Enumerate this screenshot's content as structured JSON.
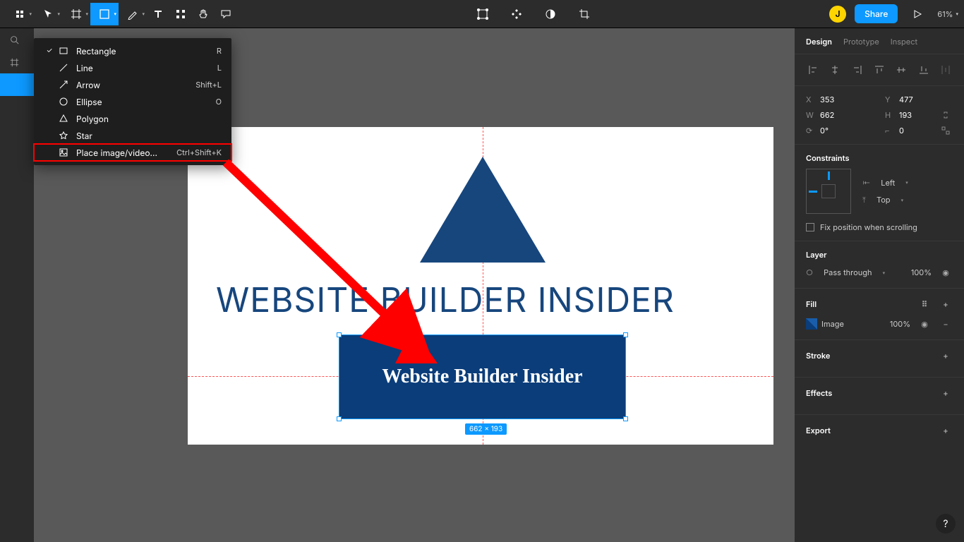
{
  "toolbar": {
    "share_label": "Share",
    "zoom": "61%",
    "avatar_initial": "J"
  },
  "dropdown": {
    "items": [
      {
        "label": "Rectangle",
        "shortcut": "R",
        "checked": true
      },
      {
        "label": "Line",
        "shortcut": "L"
      },
      {
        "label": "Arrow",
        "shortcut": "Shift+L"
      },
      {
        "label": "Ellipse",
        "shortcut": "O"
      },
      {
        "label": "Polygon",
        "shortcut": ""
      },
      {
        "label": "Star",
        "shortcut": ""
      },
      {
        "label": "Place image/video...",
        "shortcut": "Ctrl+Shift+K",
        "highlight": true
      }
    ]
  },
  "canvas": {
    "big_text": "WEBSITE BUILDER INSIDER",
    "sel_text": "Website Builder Insider",
    "dim_label": "662 × 193"
  },
  "panel": {
    "tabs": [
      "Design",
      "Prototype",
      "Inspect"
    ],
    "x_label": "X",
    "x_val": "353",
    "y_label": "Y",
    "y_val": "477",
    "w_label": "W",
    "w_val": "662",
    "h_label": "H",
    "h_val": "193",
    "rot_label": "",
    "rot_val": "0°",
    "rad_label": "",
    "rad_val": "0",
    "constraints_title": "Constraints",
    "constraint_h": "Left",
    "constraint_v": "Top",
    "fix_label": "Fix position when scrolling",
    "layer_title": "Layer",
    "layer_mode": "Pass through",
    "layer_opacity": "100%",
    "fill_title": "Fill",
    "fill_type": "Image",
    "fill_opacity": "100%",
    "stroke_title": "Stroke",
    "effects_title": "Effects",
    "export_title": "Export"
  }
}
